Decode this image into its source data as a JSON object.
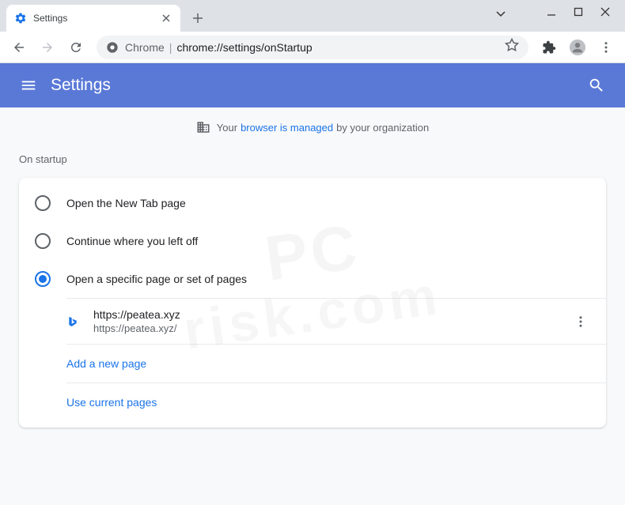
{
  "tab": {
    "title": "Settings"
  },
  "omnibox": {
    "prefix": "Chrome",
    "url": "chrome://settings/onStartup"
  },
  "header": {
    "title": "Settings"
  },
  "managed": {
    "pre": "Your",
    "link": "browser is managed",
    "post": "by your organization"
  },
  "section": {
    "title": "On startup"
  },
  "options": [
    {
      "label": "Open the New Tab page",
      "selected": false
    },
    {
      "label": "Continue where you left off",
      "selected": false
    },
    {
      "label": "Open a specific page or set of pages",
      "selected": true
    }
  ],
  "pages": [
    {
      "title": "https://peatea.xyz",
      "url": "https://peatea.xyz/"
    }
  ],
  "actions": {
    "addPage": "Add a new page",
    "useCurrent": "Use current pages"
  }
}
